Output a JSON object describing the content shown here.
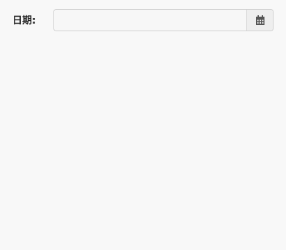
{
  "form": {
    "date_label": "日期:",
    "date_value": "",
    "date_placeholder": "",
    "calendar_icon": "calendar-icon"
  },
  "colors": {
    "background": "#f8f8f8",
    "input_border": "#cfcfcf",
    "button_bg": "#eeeeee",
    "icon": "#555555"
  }
}
